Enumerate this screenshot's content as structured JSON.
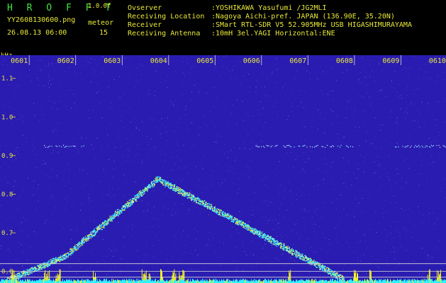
{
  "header": {
    "title": "H R O F F T",
    "version": "1.0.0f",
    "filename": "YY2608130600.png",
    "datetime": "26.08.13 06:00",
    "meteor_label": "meteor",
    "meteor_count": "15"
  },
  "station": [
    {
      "key": "Ovserver",
      "value": ":YOSHIKAWA Yasufumi /JG2MLI"
    },
    {
      "key": "Receiving Location",
      "value": ":Nagoya Aichi-pref. JAPAN (136.90E, 35.20N)"
    },
    {
      "key": "Receiver",
      "value": ":SMart RTL-SDR V5 52.905MHz USB HIGASHIMURAYAMA"
    },
    {
      "key": "Receiving Antenna",
      "value": ":10mH 3el.YAGI Horizontal:ENE"
    }
  ],
  "colors": {
    "header_green": "#3fe63f",
    "header_yellow": "#e8e83a",
    "background_blue": "#2a1cb0",
    "signal_cyan": "#2ff0ff",
    "signal_yellow": "#f5f51a"
  },
  "chart_data": {
    "type": "heatmap",
    "ylabel": "kHz",
    "x_ticks": [
      "0601",
      "0602",
      "0603",
      "0604",
      "0605",
      "0606",
      "0607",
      "0608",
      "0609",
      "0610"
    ],
    "y_ticks": [
      "1.1",
      "1.0",
      "0.9",
      "0.8",
      "0.7",
      "0.6"
    ],
    "ylim": [
      0.57,
      1.16
    ],
    "xlim_minutes": [
      0.6,
      10.2
    ],
    "grid_lines_khz": [
      0.62,
      0.6,
      0.585
    ],
    "features": [
      {
        "kind": "doppler_trace",
        "points": [
          [
            0.6,
            0.57
          ],
          [
            2.0,
            0.64
          ],
          [
            4.0,
            0.84
          ],
          [
            6.0,
            0.71
          ],
          [
            8.0,
            0.58
          ]
        ]
      },
      {
        "kind": "carrier_line",
        "khz": 0.925,
        "segments": [
          [
            1.5,
            2.4
          ],
          [
            6.1,
            8.2
          ],
          [
            9.1,
            10.2
          ]
        ]
      },
      {
        "kind": "meteor_bursts",
        "minutes": [
          0.85,
          1.55,
          1.8,
          2.6,
          3.65,
          3.8,
          4.05,
          4.3,
          4.45,
          6.8,
          8.2,
          8.55,
          9.8,
          10.0
        ]
      }
    ]
  }
}
